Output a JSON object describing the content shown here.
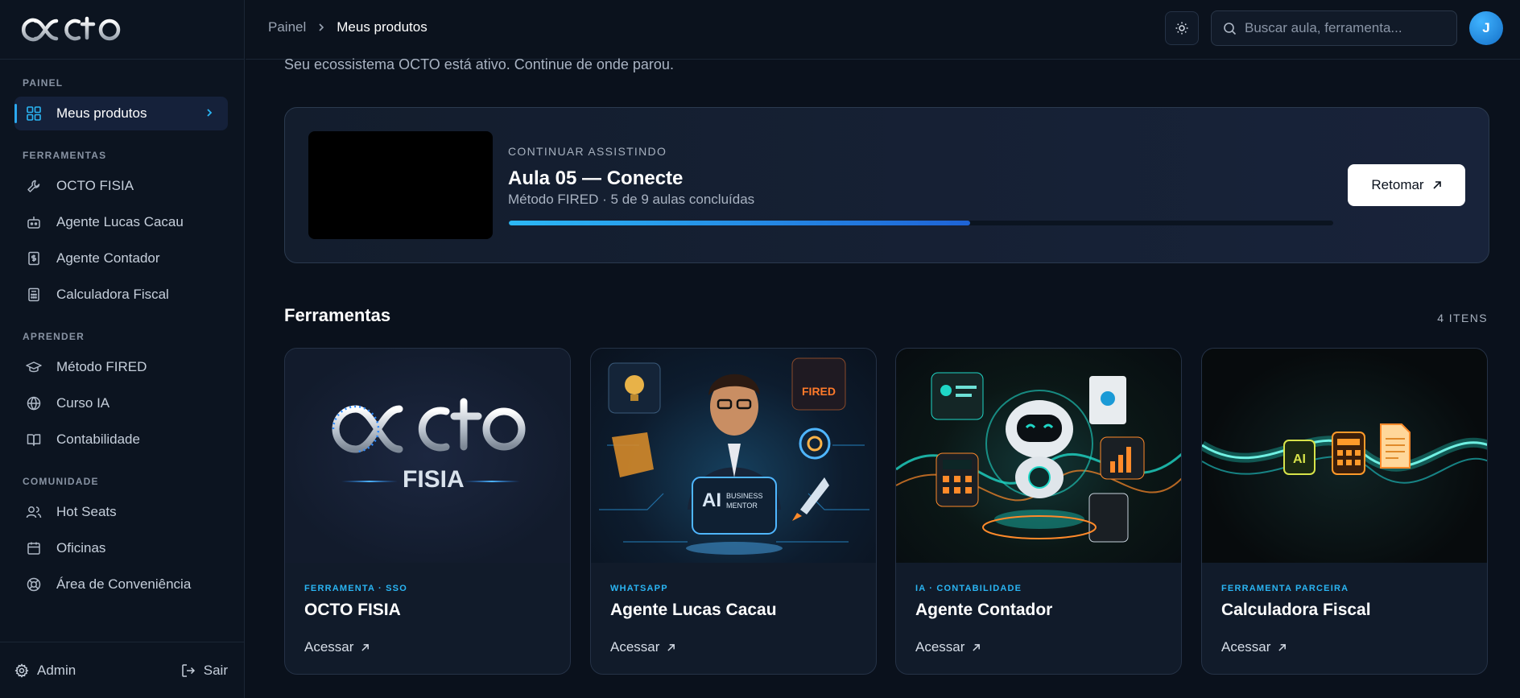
{
  "brand": {
    "logo_text": "OCTO"
  },
  "sidebar": {
    "sections": [
      {
        "title": "PAINEL",
        "items": [
          {
            "label": "Meus produtos",
            "icon": "grid-icon",
            "active": true
          }
        ]
      },
      {
        "title": "FERRAMENTAS",
        "items": [
          {
            "label": "OCTO FISIA",
            "icon": "wrench-icon"
          },
          {
            "label": "Agente Lucas Cacau",
            "icon": "bot-icon"
          },
          {
            "label": "Agente Contador",
            "icon": "receipt-icon"
          },
          {
            "label": "Calculadora Fiscal",
            "icon": "calculator-icon"
          }
        ]
      },
      {
        "title": "APRENDER",
        "items": [
          {
            "label": "Método FIRED",
            "icon": "graduation-cap-icon"
          },
          {
            "label": "Curso IA",
            "icon": "globe-icon"
          },
          {
            "label": "Contabilidade",
            "icon": "book-icon"
          }
        ]
      },
      {
        "title": "COMUNIDADE",
        "items": [
          {
            "label": "Hot Seats",
            "icon": "users-icon"
          },
          {
            "label": "Oficinas",
            "icon": "calendar-icon"
          },
          {
            "label": "Área de Conveniência",
            "icon": "lifebuoy-icon"
          }
        ]
      }
    ],
    "footer": {
      "admin_label": "Admin",
      "logout_label": "Sair"
    }
  },
  "header": {
    "breadcrumb": [
      "Painel",
      "Meus produtos"
    ],
    "search_placeholder": "Buscar aula, ferramenta...",
    "avatar_initial": "J"
  },
  "main": {
    "subtitle": "Seu ecossistema OCTO está ativo. Continue de onde parou.",
    "continue": {
      "label": "CONTINUAR ASSISTINDO",
      "title": "Aula 05 — Conecte",
      "meta": "Método FIRED · 5 de 9 aulas concluídas",
      "progress": 0.56,
      "button": "Retomar"
    },
    "tools_section": {
      "title": "Ferramentas",
      "count": "4 ITENS"
    },
    "cards": [
      {
        "tag": "FERRAMENTA · SSO",
        "name": "OCTO FISIA",
        "action": "Acessar",
        "logo_main": "OCTO",
        "logo_sub": "FISIA"
      },
      {
        "tag": "WHATSAPP",
        "name": "Agente Lucas Cacau",
        "action": "Acessar",
        "badge_main": "AI",
        "badge_text": "BUSINESS MENTOR",
        "badge_tag": "FIRED"
      },
      {
        "tag": "IA · CONTABILIDADE",
        "name": "Agente Contador",
        "action": "Acessar"
      },
      {
        "tag": "FERRAMENTA PARCEIRA",
        "name": "Calculadora Fiscal",
        "action": "Acessar",
        "icon_text": "AI"
      }
    ]
  },
  "colors": {
    "accent": "#2ab5f3",
    "background": "#0a111c",
    "card": "#111b2a"
  }
}
